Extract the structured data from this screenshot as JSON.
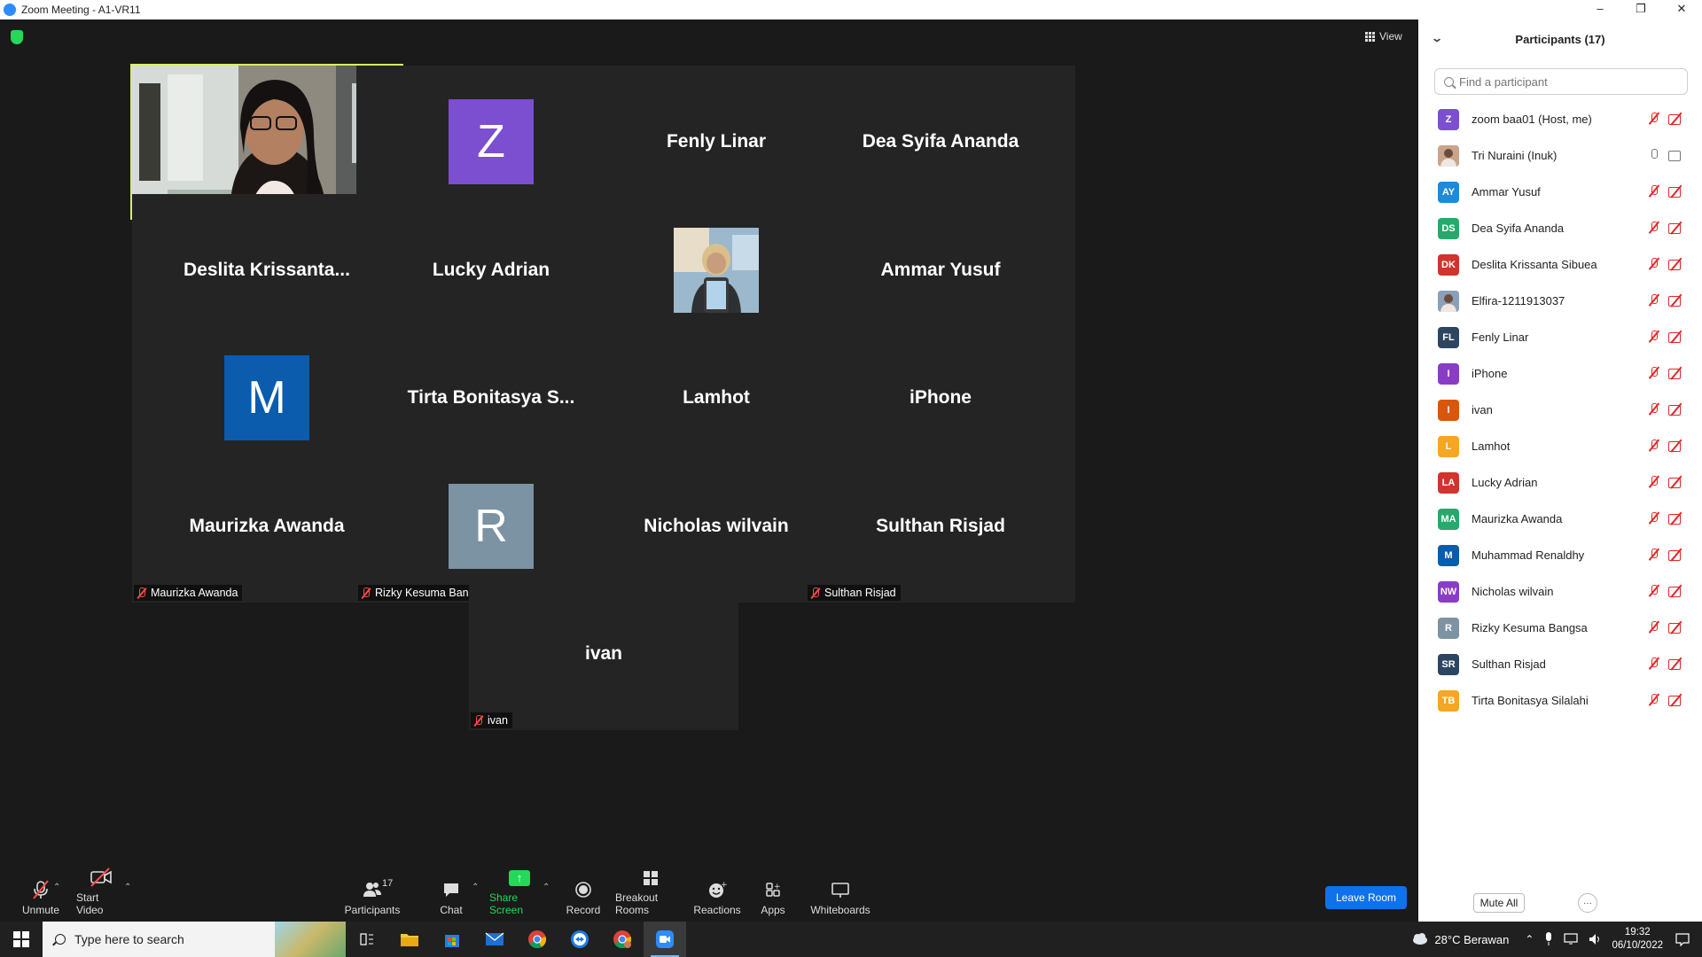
{
  "window": {
    "title": "Zoom Meeting - A1-VR11",
    "minimize": "–",
    "restore": "❐",
    "close": "✕"
  },
  "top_bar": {
    "view_label": "View"
  },
  "tiles": [
    {
      "name": "Tri Nuraini (Inuk)",
      "type": "video",
      "speaking": true
    },
    {
      "name": "zoom baa01",
      "type": "avatar",
      "letter": "Z",
      "color": "#7b4fd0"
    },
    {
      "name": "Fenly Linar",
      "type": "name",
      "display": "Fenly Linar"
    },
    {
      "name": "Dea Syifa Ananda",
      "type": "name",
      "display": "Dea Syifa Ananda"
    },
    {
      "name": "Deslita Krissanta Sibuea",
      "type": "name",
      "display": "Deslita  Krissanta..."
    },
    {
      "name": "Lucky Adrian",
      "type": "name",
      "display": "Lucky Adrian"
    },
    {
      "name": "Elfira-1211913037",
      "type": "photo"
    },
    {
      "name": "Ammar Yusuf",
      "type": "name",
      "display": "Ammar Yusuf"
    },
    {
      "name": "Muhammad Renaldhy",
      "type": "avatar",
      "letter": "M",
      "color": "#0b5cad"
    },
    {
      "name": "Tirta Bonitasya Silalahi",
      "type": "name",
      "display": "Tirta Bonitasya S..."
    },
    {
      "name": "Lamhot",
      "type": "name",
      "display": "Lamhot"
    },
    {
      "name": "iPhone",
      "type": "name",
      "display": "iPhone"
    },
    {
      "name": "Maurizka Awanda",
      "type": "name",
      "display": "Maurizka Awanda"
    },
    {
      "name": "Rizky Kesuma Bangsa",
      "type": "avatar",
      "letter": "R",
      "color": "#7b93a3"
    },
    {
      "name": "Nicholas wilvain",
      "type": "name",
      "display": "Nicholas wilvain"
    },
    {
      "name": "Sulthan Risjad",
      "type": "name",
      "display": "Sulthan Risjad"
    },
    {
      "name": "ivan",
      "type": "name",
      "display": "ivan"
    }
  ],
  "toolbar": {
    "unmute": "Unmute",
    "start_video": "Start Video",
    "participants": "Participants",
    "participants_count": "17",
    "chat": "Chat",
    "share_screen": "Share Screen",
    "record": "Record",
    "breakout_rooms": "Breakout Rooms",
    "reactions": "Reactions",
    "apps": "Apps",
    "whiteboards": "Whiteboards",
    "leave": "Leave Room"
  },
  "panel": {
    "title": "Participants (17)",
    "search_placeholder": "Find a participant",
    "mute_all": "Mute All",
    "more": "···",
    "participants": [
      {
        "initials": "Z",
        "name": "zoom baa01 (Host, me)",
        "color": "#7b4fd0",
        "mic_on": false,
        "cam_on": false
      },
      {
        "initials": "",
        "name": "Tri Nuraini (Inuk)",
        "color": "#c9a48a",
        "mic_on": true,
        "cam_on": true,
        "photo": true
      },
      {
        "initials": "AY",
        "name": "Ammar Yusuf",
        "color": "#1f8ad8",
        "mic_on": false,
        "cam_on": false
      },
      {
        "initials": "DS",
        "name": "Dea Syifa Ananda",
        "color": "#27a96b",
        "mic_on": false,
        "cam_on": false
      },
      {
        "initials": "DK",
        "name": "Deslita Krissanta Sibuea",
        "color": "#d0342c",
        "mic_on": false,
        "cam_on": false
      },
      {
        "initials": "",
        "name": "Elfira-1211913037",
        "color": "#8aa0b8",
        "mic_on": false,
        "cam_on": false,
        "photo": true
      },
      {
        "initials": "FL",
        "name": "Fenly Linar",
        "color": "#2d4560",
        "mic_on": false,
        "cam_on": false
      },
      {
        "initials": "I",
        "name": "iPhone",
        "color": "#8a3cc4",
        "mic_on": false,
        "cam_on": false
      },
      {
        "initials": "I",
        "name": "ivan",
        "color": "#d9560f",
        "mic_on": false,
        "cam_on": false
      },
      {
        "initials": "L",
        "name": "Lamhot",
        "color": "#f5a623",
        "mic_on": false,
        "cam_on": false
      },
      {
        "initials": "LA",
        "name": "Lucky Adrian",
        "color": "#d0342c",
        "mic_on": false,
        "cam_on": false
      },
      {
        "initials": "MA",
        "name": "Maurizka Awanda",
        "color": "#27a96b",
        "mic_on": false,
        "cam_on": false
      },
      {
        "initials": "M",
        "name": "Muhammad Renaldhy",
        "color": "#0b5cad",
        "mic_on": false,
        "cam_on": false
      },
      {
        "initials": "NW",
        "name": "Nicholas wilvain",
        "color": "#8a3cc4",
        "mic_on": false,
        "cam_on": false
      },
      {
        "initials": "R",
        "name": "Rizky Kesuma Bangsa",
        "color": "#7b93a3",
        "mic_on": false,
        "cam_on": false
      },
      {
        "initials": "SR",
        "name": "Sulthan Risjad",
        "color": "#2d4560",
        "mic_on": false,
        "cam_on": false
      },
      {
        "initials": "TB",
        "name": "Tirta Bonitasya Silalahi",
        "color": "#f5a623",
        "mic_on": false,
        "cam_on": false
      }
    ]
  },
  "taskbar": {
    "search_placeholder": "Type here to search",
    "weather": "28°C  Berawan",
    "time": "19:32",
    "date": "06/10/2022"
  }
}
